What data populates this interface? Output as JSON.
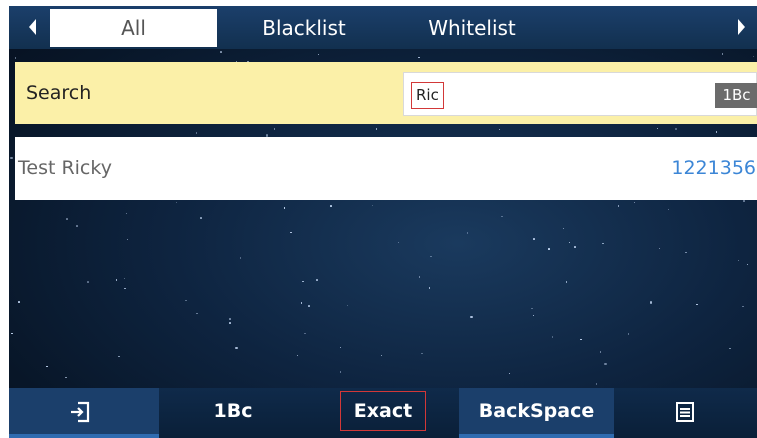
{
  "tabs": {
    "left_arrow_icon": "triangle-left",
    "right_arrow_icon": "triangle-right",
    "items": [
      {
        "label": "All",
        "selected": true
      },
      {
        "label": "Blacklist",
        "selected": false
      },
      {
        "label": "Whitelist",
        "selected": false
      }
    ]
  },
  "search": {
    "label": "Search",
    "value": "Ric",
    "input_mode": "1Bc"
  },
  "results": [
    {
      "name": "Test Ricky",
      "number": "1221356"
    }
  ],
  "softkeys": {
    "exit_icon": "exit-icon",
    "input_mode": "1Bc",
    "exact": "Exact",
    "backspace": "BackSpace",
    "menu_icon": "menu-icon"
  },
  "colors": {
    "accent": "#1b3f6b",
    "search_highlight": "#fbf0a8",
    "number_link": "#3c86d6",
    "focus_border": "#d23838"
  }
}
